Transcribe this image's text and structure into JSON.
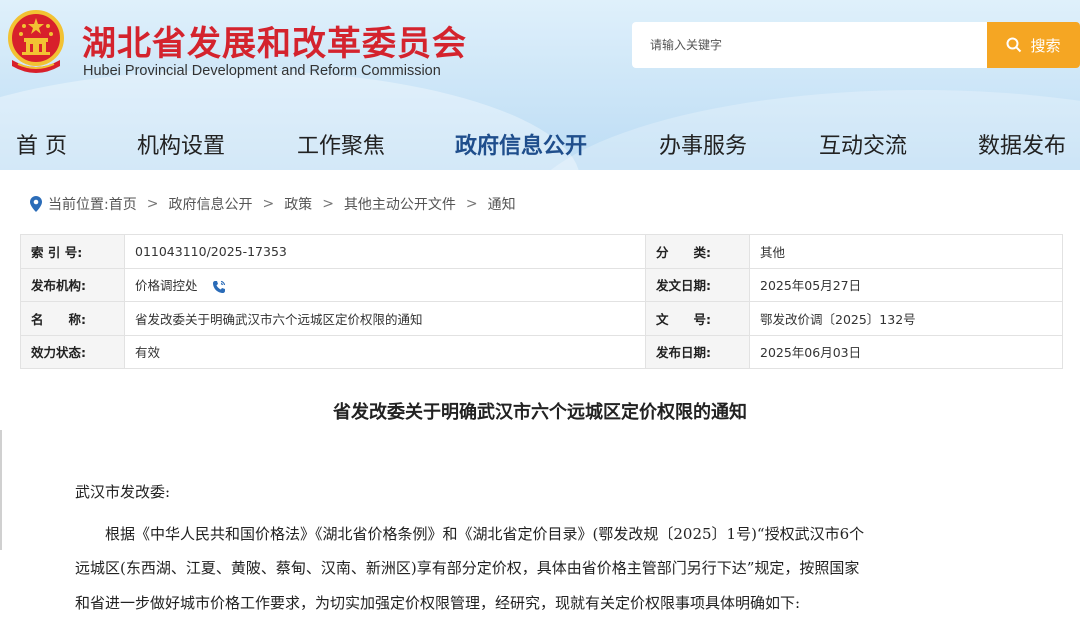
{
  "header": {
    "title": "湖北省发展和改革委员会",
    "subtitle": "Hubei Provincial Development and Reform Commission",
    "search_placeholder": "请输入关键字",
    "search_button": "搜索",
    "emblem_icon": "national-emblem-icon",
    "colors": {
      "title_red": "#d4232d",
      "search_orange": "#f5a623",
      "nav_active": "#1f4e8c"
    }
  },
  "nav": {
    "items": [
      {
        "label": "首 页"
      },
      {
        "label": "机构设置"
      },
      {
        "label": "工作聚焦"
      },
      {
        "label": "政府信息公开",
        "active": true
      },
      {
        "label": "办事服务"
      },
      {
        "label": "互动交流"
      },
      {
        "label": "数据发布"
      }
    ]
  },
  "breadcrumb": {
    "prefix": "当前位置:",
    "items": [
      "首页",
      "政府信息公开",
      "政策",
      "其他主动公开文件",
      "通知"
    ],
    "separator": ">"
  },
  "info": {
    "rows": [
      {
        "l1": "索 引 号:",
        "v1": "011043110/2025-17353",
        "l2": "分　　类:",
        "v2": "其他"
      },
      {
        "l1": "发布机构:",
        "v1": "价格调控处",
        "l2": "发文日期:",
        "v2": "2025年05月27日"
      },
      {
        "l1": "名　　称:",
        "v1": "省发改委关于明确武汉市六个远城区定价权限的通知",
        "l2": "文　　号:",
        "v2": "鄂发改价调〔2025〕132号"
      },
      {
        "l1": "效力状态:",
        "v1": "有效",
        "l2": "发布日期:",
        "v2": "2025年06月03日"
      }
    ]
  },
  "article": {
    "title": "省发改委关于明确武汉市六个远城区定价权限的通知",
    "greeting": "武汉市发改委:",
    "lines": [
      "　　根据《中华人民共和国价格法》《湖北省价格条例》和《湖北省定价目录》(鄂发改规〔2025〕1号)“授权武汉市6个",
      "远城区(东西湖、江夏、黄陂、蔡甸、汉南、新洲区)享有部分定价权，具体由省价格主管部门另行下达”规定，按照国家",
      "和省进一步做好城市价格工作要求，为切实加强定价权限管理，经研究，现就有关定价权限事项具体明确如下:"
    ]
  }
}
